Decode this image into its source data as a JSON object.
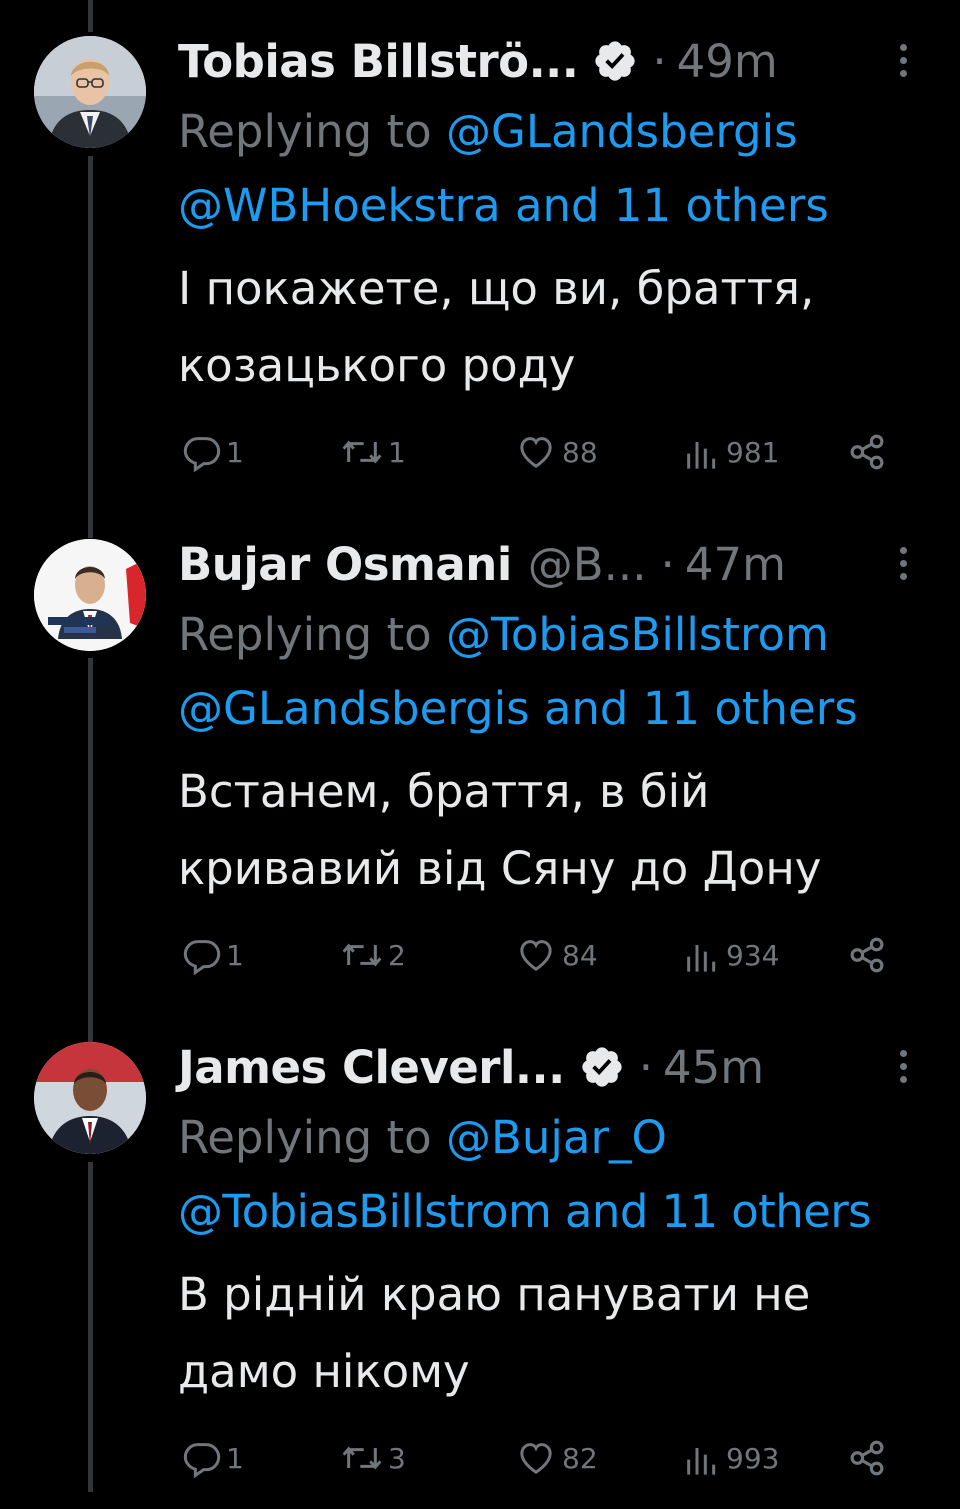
{
  "tweets": [
    {
      "name": "Tobias Billströ...",
      "handle": "",
      "verified": true,
      "time": "49m",
      "replying_prefix": "Replying to ",
      "reply_line1_mention": "@GLandsbergis",
      "reply_line2_mention": "@WBHoekstra",
      "reply_line2_rest": " and 11 others",
      "body_line1": "І покажете, що ви, браття,",
      "body_line2": "козацького роду",
      "replies": "1",
      "retweets": "1",
      "likes": "88",
      "views": "981"
    },
    {
      "name": "Bujar Osmani",
      "handle": "@B...",
      "verified": false,
      "time": "47m",
      "replying_prefix": "Replying to ",
      "reply_line1_mention": "@TobiasBillstrom",
      "reply_line2_mention": "@GLandsbergis",
      "reply_line2_rest": " and 11 others",
      "body_line1": "Встанем, браття, в бій",
      "body_line2": "кривавий від Сяну до Дону",
      "replies": "1",
      "retweets": "2",
      "likes": "84",
      "views": "934"
    },
    {
      "name": "James Cleverl...",
      "handle": "",
      "verified": true,
      "time": "45m",
      "replying_prefix": "Replying to ",
      "reply_line1_mention": "@Bujar_O",
      "reply_line2_mention": "@TobiasBillstrom",
      "reply_line2_rest": " and 11 others",
      "body_line1": "В рідній краю панувати не",
      "body_line2": "дамо нікому",
      "replies": "1",
      "retweets": "3",
      "likes": "82",
      "views": "993"
    }
  ],
  "colors": {
    "background": "#000000",
    "text": "#e7e9ea",
    "muted": "#71767b",
    "link": "#1d9bf0",
    "thread_line": "#333639"
  }
}
